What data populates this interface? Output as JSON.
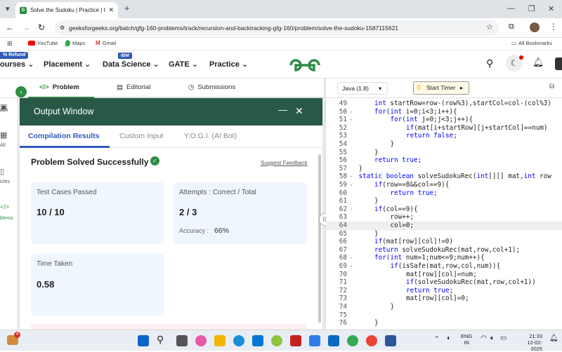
{
  "browser": {
    "tab_title": "Solve the Sudoku | Practice | Ge",
    "url": "geeksforgeeks.org/batch/gfg-160-problems/track/recursion-and-backtracking-gfg-160/problem/solve-the-sudoku-1587115621",
    "bookmarks": [
      "YouTube",
      "Maps",
      "Gmail"
    ],
    "all_bookmarks": "All Bookmarks"
  },
  "nav": {
    "refund_badge": "% Refund",
    "ibm_badge": "IBM",
    "items": [
      "ourses",
      "Placement",
      "Data Science",
      "GATE",
      "Practice"
    ]
  },
  "problem_tabs": [
    "Problem",
    "Editorial",
    "Submissions"
  ],
  "sidebar": [
    "ash",
    "All",
    "icles",
    "blems"
  ],
  "output": {
    "title": "Output Window",
    "tabs": [
      "Compilation Results",
      "Custom Input",
      "Y.O.G.I. (AI Bot)"
    ],
    "status": "Problem Solved Successfully",
    "feedback": "Suggest Feedback",
    "tests_label": "Test Cases Passed",
    "tests_value": "10 / 10",
    "attempts_label": "Attempts : Correct / Total",
    "attempts_value": "2 / 3",
    "accuracy_label": "Accuracy :",
    "accuracy_value": "66%",
    "time_label": "Time Taken",
    "time_value": "0.58"
  },
  "editor": {
    "language": "Java (1.8)",
    "timer": "Start Timer",
    "lines": [
      {
        "n": "49",
        "i": 2,
        "t": "int startRow=row-(row%3),startCol=col-(col%3)"
      },
      {
        "n": "50",
        "i": 2,
        "t": "for(int i=0;i<3;i++){"
      },
      {
        "n": "51",
        "i": 3,
        "t": "for(int j=0;j<3;j++){"
      },
      {
        "n": "52",
        "i": 4,
        "t": "if(mat[i+startRow][j+startCol]==num)"
      },
      {
        "n": "53",
        "i": 4,
        "t": "return false;"
      },
      {
        "n": "54",
        "i": 3,
        "t": "}"
      },
      {
        "n": "55",
        "i": 2,
        "t": "}"
      },
      {
        "n": "56",
        "i": 2,
        "t": "return true;"
      },
      {
        "n": "57",
        "i": 1,
        "t": "}"
      },
      {
        "n": "58",
        "i": 1,
        "t": "static boolean solveSudokuRec(int[][] mat,int row"
      },
      {
        "n": "59",
        "i": 2,
        "t": "if(row==8&&col==9){"
      },
      {
        "n": "60",
        "i": 3,
        "t": "return true;"
      },
      {
        "n": "61",
        "i": 2,
        "t": "}"
      },
      {
        "n": "62",
        "i": 2,
        "t": "if(col==9){"
      },
      {
        "n": "63",
        "i": 3,
        "t": "row++;"
      },
      {
        "n": "64",
        "i": 3,
        "t": "col=0;"
      },
      {
        "n": "65",
        "i": 2,
        "t": "}"
      },
      {
        "n": "66",
        "i": 2,
        "t": "if(mat[row][col]!=0)"
      },
      {
        "n": "67",
        "i": 2,
        "t": "return solveSudokuRec(mat,row,col+1);"
      },
      {
        "n": "68",
        "i": 2,
        "t": "for(int num=1;num<=9;num++){"
      },
      {
        "n": "69",
        "i": 3,
        "t": "if(isSafe(mat,row,col,num)){"
      },
      {
        "n": "70",
        "i": 4,
        "t": "mat[row][col]=num;"
      },
      {
        "n": "71",
        "i": 4,
        "t": "if(solveSudokuRec(mat,row,col+1))"
      },
      {
        "n": "72",
        "i": 4,
        "t": "return true;"
      },
      {
        "n": "73",
        "i": 4,
        "t": "mat[row][col]=0;"
      },
      {
        "n": "74",
        "i": 3,
        "t": "}"
      },
      {
        "n": "75",
        "i": 2,
        "t": ""
      },
      {
        "n": "76",
        "i": 2,
        "t": "}"
      }
    ]
  },
  "taskbar": {
    "lang": "ENG",
    "region": "IN",
    "time": "21:33",
    "date": "12-02-2025",
    "badge": "4"
  }
}
